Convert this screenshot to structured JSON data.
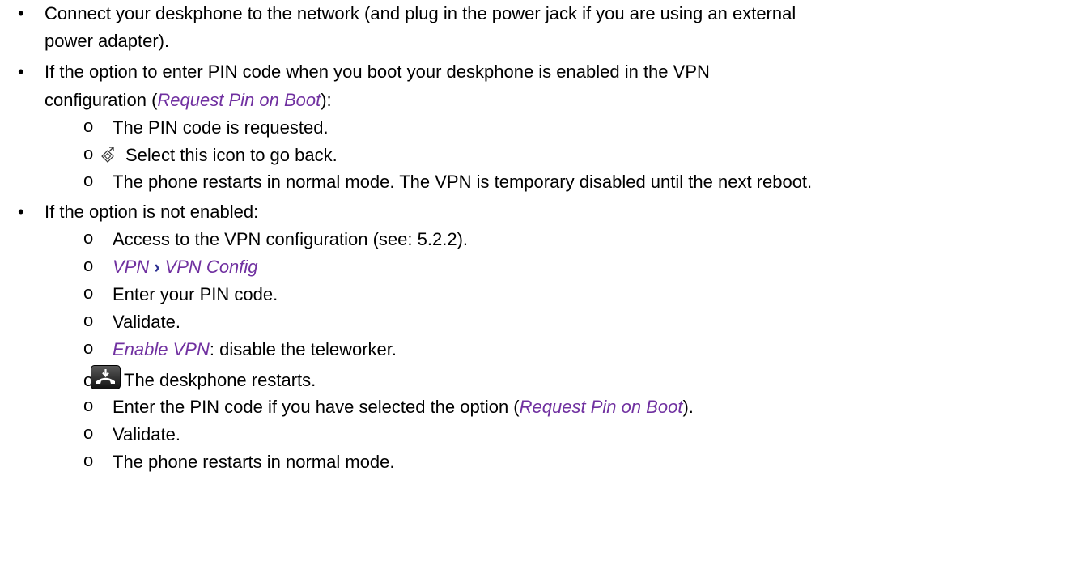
{
  "colors": {
    "link": "#7030a0",
    "separator": "#2e3192",
    "text": "#000000"
  },
  "bullet_symbol": "•",
  "sub_bullet_symbol": "o",
  "items": [
    {
      "l1": "Connect your deskphone to the network (and plug in the power jack if you are using an external",
      "l2": "power adapter)."
    },
    {
      "l1": "If the option to enter PIN code when you boot your deskphone is enabled in the VPN",
      "l2_pre": "configuration (",
      "l2_link": "Request Pin on Boot",
      "l2_post": "):"
    },
    {
      "l1": "If the option is not enabled:"
    }
  ],
  "sub_a": [
    {
      "text": "The PIN code is requested."
    },
    {
      "icon": "go-back-diamond-icon",
      "text": "Select this icon to go back."
    },
    {
      "text": "The phone restarts in normal mode. The VPN is temporary disabled until the next reboot."
    }
  ],
  "sub_b": [
    {
      "text": "Access to the VPN configuration (see: 5.2.2)."
    },
    {
      "link1": "VPN",
      "sep": "›",
      "link2": "VPN Config"
    },
    {
      "text": "Enter your PIN code."
    },
    {
      "text": "Validate."
    },
    {
      "link": "Enable VPN",
      "text": ": disable the teleworker."
    },
    {
      "icon": "hang-up-phone-icon",
      "text": "The deskphone restarts."
    },
    {
      "pre": "Enter the PIN code if you have selected the option (",
      "link": "Request Pin on Boot",
      "post": ")."
    },
    {
      "text": "Validate."
    },
    {
      "text": "The phone restarts in normal mode."
    }
  ]
}
